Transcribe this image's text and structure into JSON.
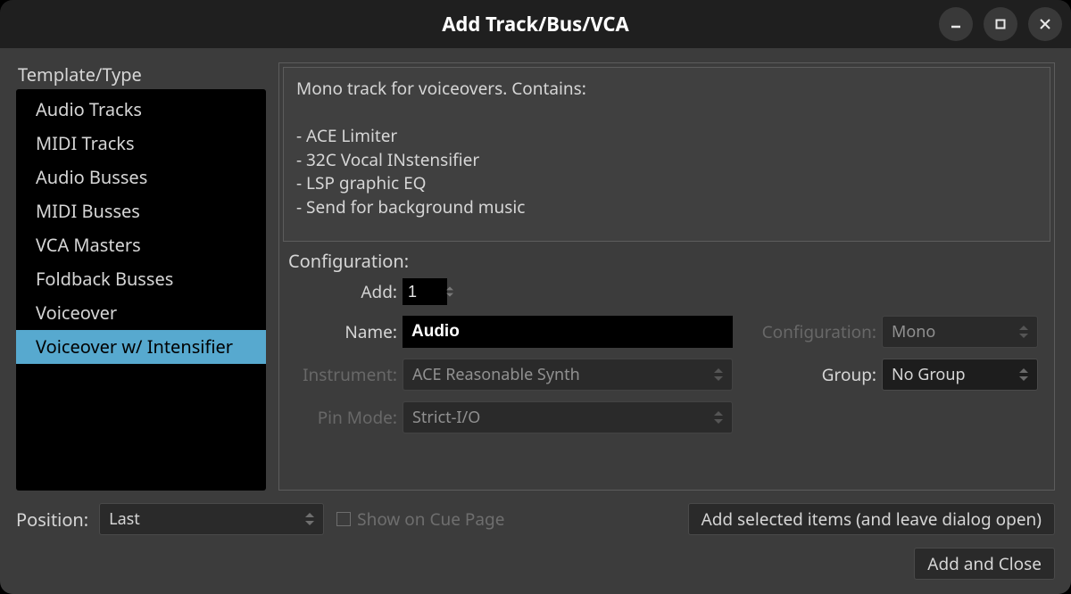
{
  "window": {
    "title": "Add Track/Bus/VCA"
  },
  "sidebar": {
    "heading": "Template/Type",
    "items": [
      {
        "label": "Audio Tracks"
      },
      {
        "label": "MIDI Tracks"
      },
      {
        "label": "Audio Busses"
      },
      {
        "label": "MIDI Busses"
      },
      {
        "label": "VCA Masters"
      },
      {
        "label": "Foldback Busses"
      },
      {
        "label": "Voiceover"
      },
      {
        "label": "Voiceover w/ Intensifier"
      }
    ],
    "selected_index": 7
  },
  "description": "Mono track for voiceovers. Contains:\n\n- ACE Limiter\n- 32C Vocal INstensifier\n- LSP graphic EQ\n- Send for background music",
  "config": {
    "heading": "Configuration:",
    "add_label": "Add:",
    "add_value": "1",
    "name_label": "Name:",
    "name_value": "Audio",
    "configuration_label": "Configuration:",
    "configuration_value": "Mono",
    "instrument_label": "Instrument:",
    "instrument_value": "ACE Reasonable Synth",
    "group_label": "Group:",
    "group_value": "No Group",
    "pinmode_label": "Pin Mode:",
    "pinmode_value": "Strict-I/O"
  },
  "footer": {
    "position_label": "Position:",
    "position_value": "Last",
    "show_cue_label": "Show on Cue Page",
    "show_cue_checked": false,
    "add_leave_open": "Add selected items (and leave dialog open)",
    "add_and_close": "Add and Close"
  }
}
